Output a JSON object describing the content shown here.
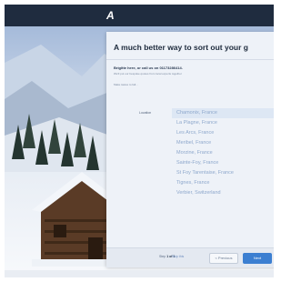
{
  "header": {
    "logo_text": "",
    "nav_items": [
      "",
      "",
      ""
    ]
  },
  "panel": {
    "headline": "A much better way to sort out your g",
    "intro": "Brigitte here, or call us on 01173286414.",
    "sub": "We'll put our bespoke quotes from local experts together",
    "sub2": "Make tastes to fall..."
  },
  "location": {
    "label": "Location",
    "selected_index": 0,
    "options": [
      "Chamonix, France",
      "La Plagne, France",
      "Les Arcs, France",
      "Meribel, France",
      "Morzine, France",
      "Sainte-Foy, France",
      "St Foy Tarentaise, France",
      "Tignes, France",
      "Verbier, Switzerland"
    ]
  },
  "footer": {
    "step_prefix": "Step",
    "step_value": "1 of 1",
    "skip_label": "Skip this",
    "previous_label": "< Previous",
    "next_label": "Next"
  },
  "colors": {
    "topbar": "#1f2c3f",
    "accent": "#3c7fd1",
    "option_text": "#8ea8cc"
  },
  "icons": {
    "logo": "brand-logo-icon"
  }
}
